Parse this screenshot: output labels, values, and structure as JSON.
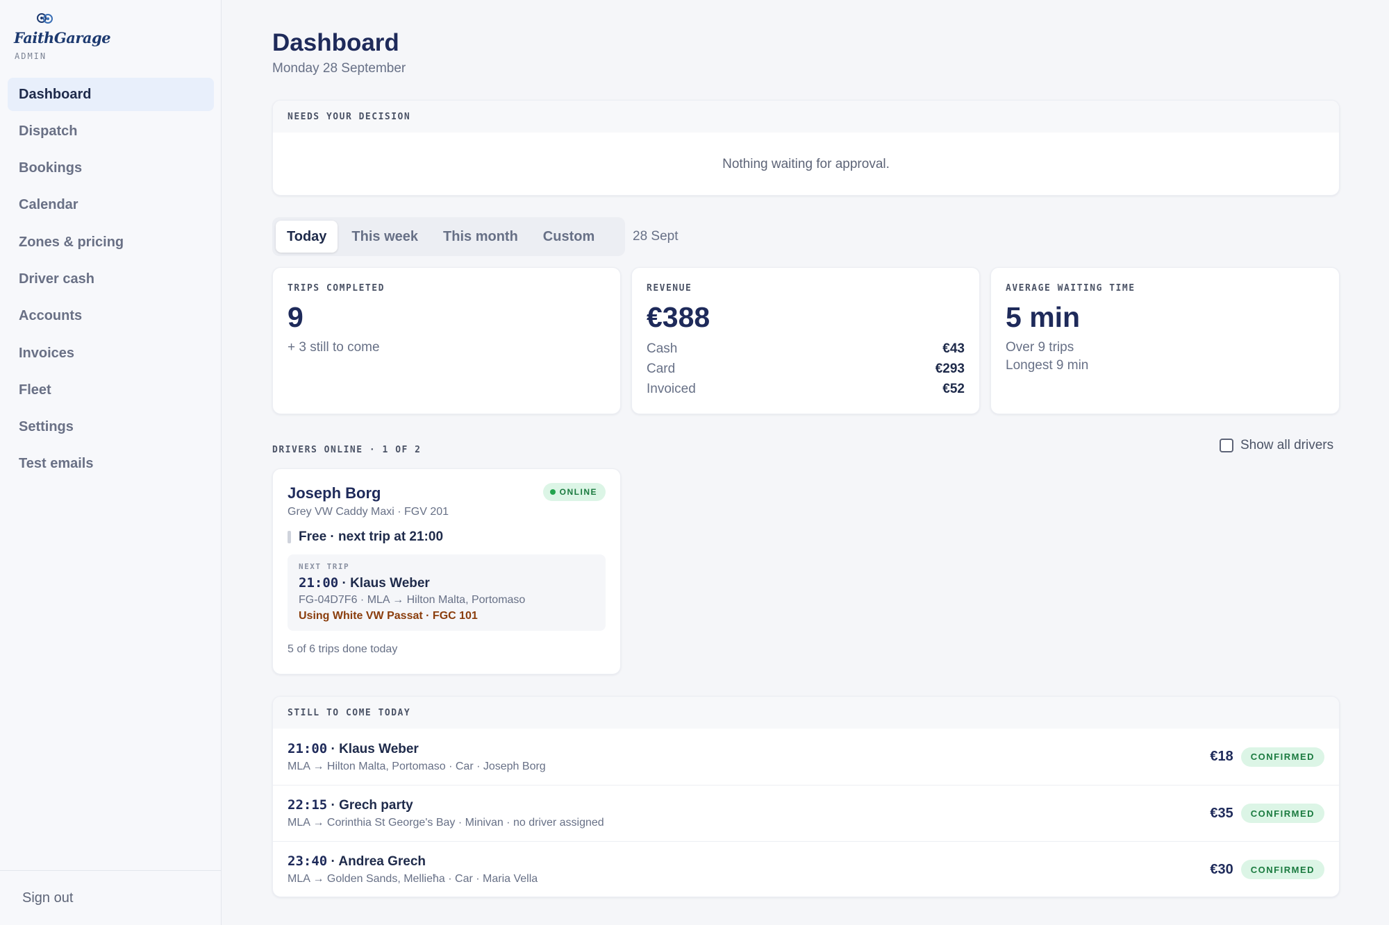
{
  "brand": {
    "name": "FaithGarage",
    "sub": "ADMIN"
  },
  "nav": {
    "items": [
      {
        "label": "Dashboard"
      },
      {
        "label": "Dispatch"
      },
      {
        "label": "Bookings"
      },
      {
        "label": "Calendar"
      },
      {
        "label": "Zones & pricing"
      },
      {
        "label": "Driver cash"
      },
      {
        "label": "Accounts"
      },
      {
        "label": "Invoices"
      },
      {
        "label": "Fleet"
      },
      {
        "label": "Settings"
      },
      {
        "label": "Test emails"
      }
    ],
    "sign_out": "Sign out"
  },
  "header": {
    "title": "Dashboard",
    "date": "Monday 28 September"
  },
  "decision": {
    "heading": "NEEDS YOUR DECISION",
    "empty": "Nothing waiting for approval."
  },
  "period": {
    "tabs": [
      {
        "label": "Today"
      },
      {
        "label": "This week"
      },
      {
        "label": "This month"
      },
      {
        "label": "Custom"
      }
    ],
    "date": "28 Sept"
  },
  "stats": {
    "trips": {
      "label": "TRIPS COMPLETED",
      "value": "9",
      "sub": "+ 3 still to come"
    },
    "revenue": {
      "label": "REVENUE",
      "value": "€388",
      "rows": [
        {
          "k": "Cash",
          "v": "€43"
        },
        {
          "k": "Card",
          "v": "€293"
        },
        {
          "k": "Invoiced",
          "v": "€52"
        }
      ]
    },
    "waiting": {
      "label": "AVERAGE WAITING TIME",
      "value": "5 min",
      "sub1": "Over 9 trips",
      "sub2": "Longest 9 min"
    }
  },
  "drivers": {
    "label": "DRIVERS ONLINE · 1 OF 2",
    "show_all": "Show all drivers",
    "list": [
      {
        "name": "Joseph Borg",
        "vehicle": "Grey VW Caddy Maxi · FGV 201",
        "badge": "ONLINE",
        "status": "Free · next trip at 21:00",
        "next_label": "NEXT TRIP",
        "next_time": "21:00",
        "next_name": " · Klaus Weber",
        "next_route": "FG-04D7F6 · MLA → Hilton Malta, Portomaso",
        "next_using": "Using White VW Passat · FGC 101",
        "trips_done": "5 of 6 trips done today"
      }
    ]
  },
  "upcoming": {
    "heading": "STILL TO COME TODAY",
    "rows": [
      {
        "time": "21:00",
        "name": " · Klaus Weber",
        "sub": "MLA → Hilton Malta, Portomaso · Car · Joseph Borg",
        "price": "€18",
        "status": "CONFIRMED"
      },
      {
        "time": "22:15",
        "name": " · Grech party",
        "sub": "MLA → Corinthia St George's Bay · Minivan · no driver assigned",
        "price": "€35",
        "status": "CONFIRMED"
      },
      {
        "time": "23:40",
        "name": " · Andrea Grech",
        "sub": "MLA → Golden Sands, Mellieħa · Car · Maria Vella",
        "price": "€30",
        "status": "CONFIRMED"
      }
    ]
  },
  "colors": {
    "accent": "#1e2a5a",
    "active_nav": "#e8effb",
    "success_bg": "#dcf5e6",
    "success_fg": "#1a7a3f",
    "warning": "#8a3d0c"
  }
}
